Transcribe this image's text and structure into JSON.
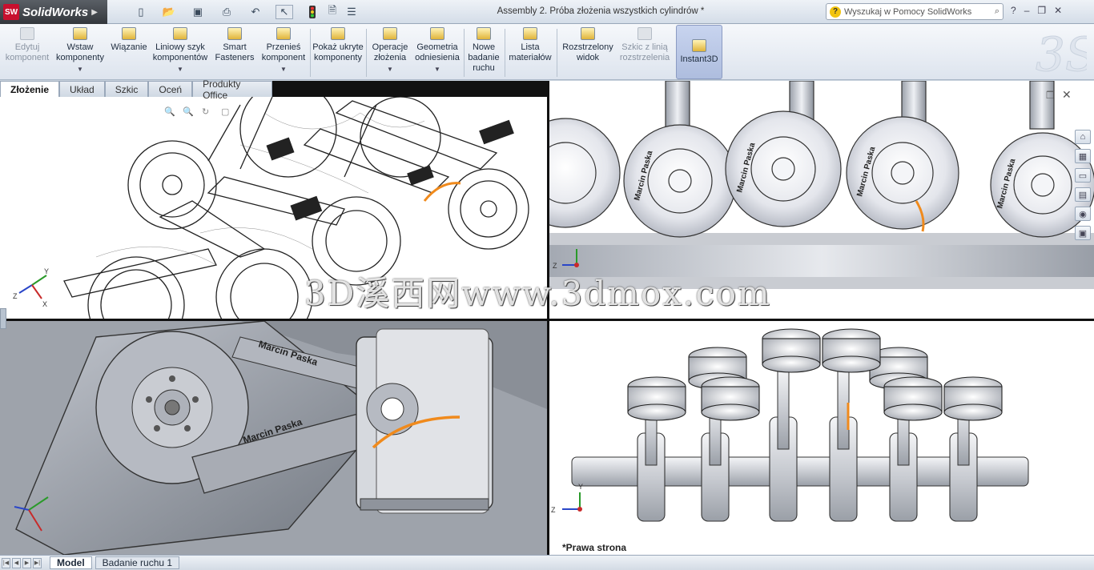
{
  "app": {
    "brand": "SolidWorks",
    "logo_badge": "SW"
  },
  "window": {
    "title": "Assembly 2. Próba złożenia wszystkich cylindrów *"
  },
  "search": {
    "placeholder": "Wyszukaj w Pomocy SolidWorks"
  },
  "ribbon": {
    "edit_component": "Edytuj komponent",
    "insert_components": "Wstaw komponenty",
    "mate": "Wiązanie",
    "linear_pattern": "Liniowy szyk komponentów",
    "smart_fasteners": "Smart Fasteners",
    "move_component": "Przenieś komponent",
    "show_hidden": "Pokaż ukryte komponenty",
    "assembly_features": "Operacje złożenia",
    "reference_geometry": "Geometria odniesienia",
    "new_motion_study": "Nowe badanie ruchu",
    "bom": "Lista materiałów",
    "exploded_view": "Rozstrzelony widok",
    "explode_line_sketch": "Szkic z linią rozstrzelenia",
    "instant3d": "Instant3D"
  },
  "tabs": [
    "Złożenie",
    "Układ",
    "Szkic",
    "Oceń",
    "Produkty Office"
  ],
  "viewports": {
    "bottom_right_label": "*Prawa strona",
    "piston_text": "Marcin Paska"
  },
  "watermark": "3D溪西网www.3dmox.com",
  "bottom_tabs": [
    "Model",
    "Badanie ruchu 1"
  ],
  "colors": {
    "accent_orange": "#f08a1c",
    "sw_red": "#c8102e"
  }
}
